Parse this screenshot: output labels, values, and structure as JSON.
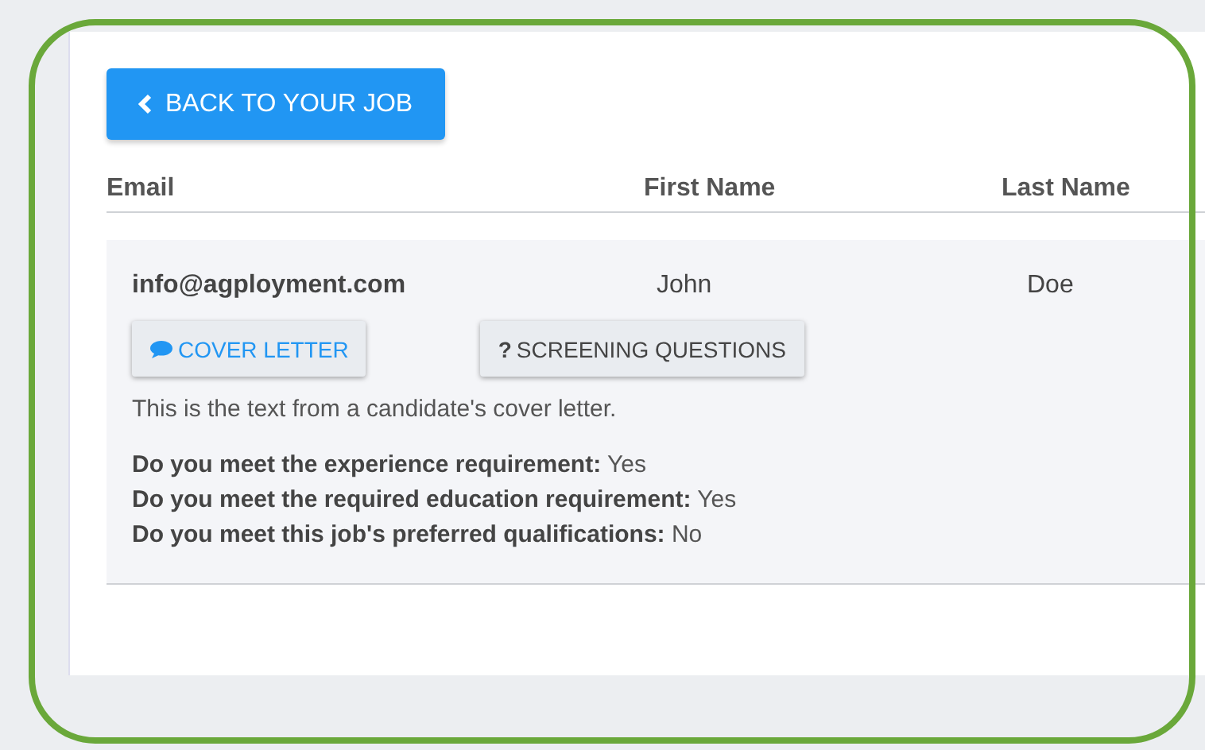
{
  "back_button": {
    "label": "BACK TO YOUR JOB"
  },
  "table": {
    "columns": [
      "Email",
      "First Name",
      "Last Name"
    ],
    "rows": [
      {
        "email": "info@agployment.com",
        "first_name": "John",
        "last_name": "Doe",
        "buttons": [
          {
            "kind": "comment",
            "label": "COVER LETTER"
          },
          {
            "kind": "question",
            "icon": "?",
            "label": "SCREENING QUESTIONS"
          }
        ],
        "cover_letter": "This is the text from a candidate's cover letter.",
        "answers": [
          "**Do you meet the experience requirement:** Yes",
          "**Do you meet the required education requirement:** Yes",
          "**Do you meet this job's preferred qualifications:** No"
        ]
      }
    ]
  }
}
